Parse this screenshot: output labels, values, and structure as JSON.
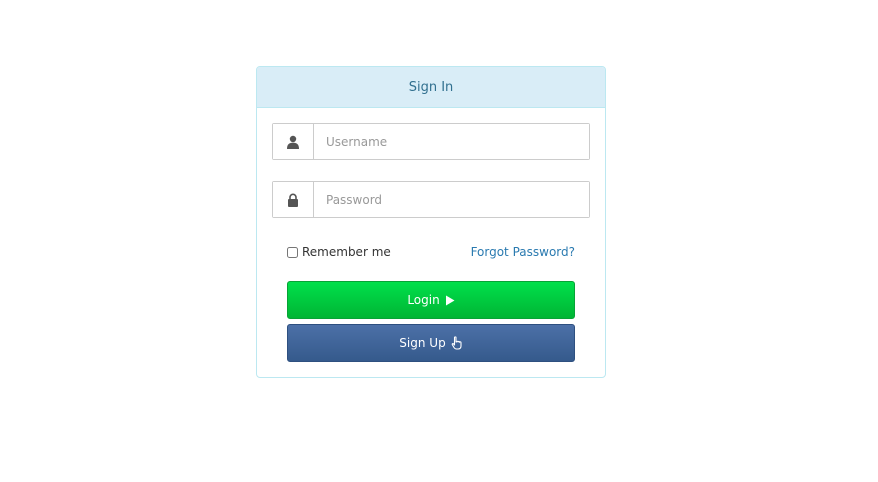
{
  "panel": {
    "title": "Sign In"
  },
  "form": {
    "username_placeholder": "Username",
    "password_placeholder": "Password",
    "remember_label": "Remember me",
    "remember_checked": false,
    "forgot_label": "Forgot Password?",
    "login_label": "Login",
    "signup_label": "Sign Up"
  },
  "icons": {
    "username": "user-icon",
    "password": "lock-icon",
    "login": "play-icon",
    "signup": "hand-pointer-icon"
  },
  "colors": {
    "heading_bg": "#d9edf7",
    "heading_text": "#31708f",
    "link": "#2a7ab0",
    "login_button": "#00c83e",
    "signup_button": "#3f6498"
  }
}
